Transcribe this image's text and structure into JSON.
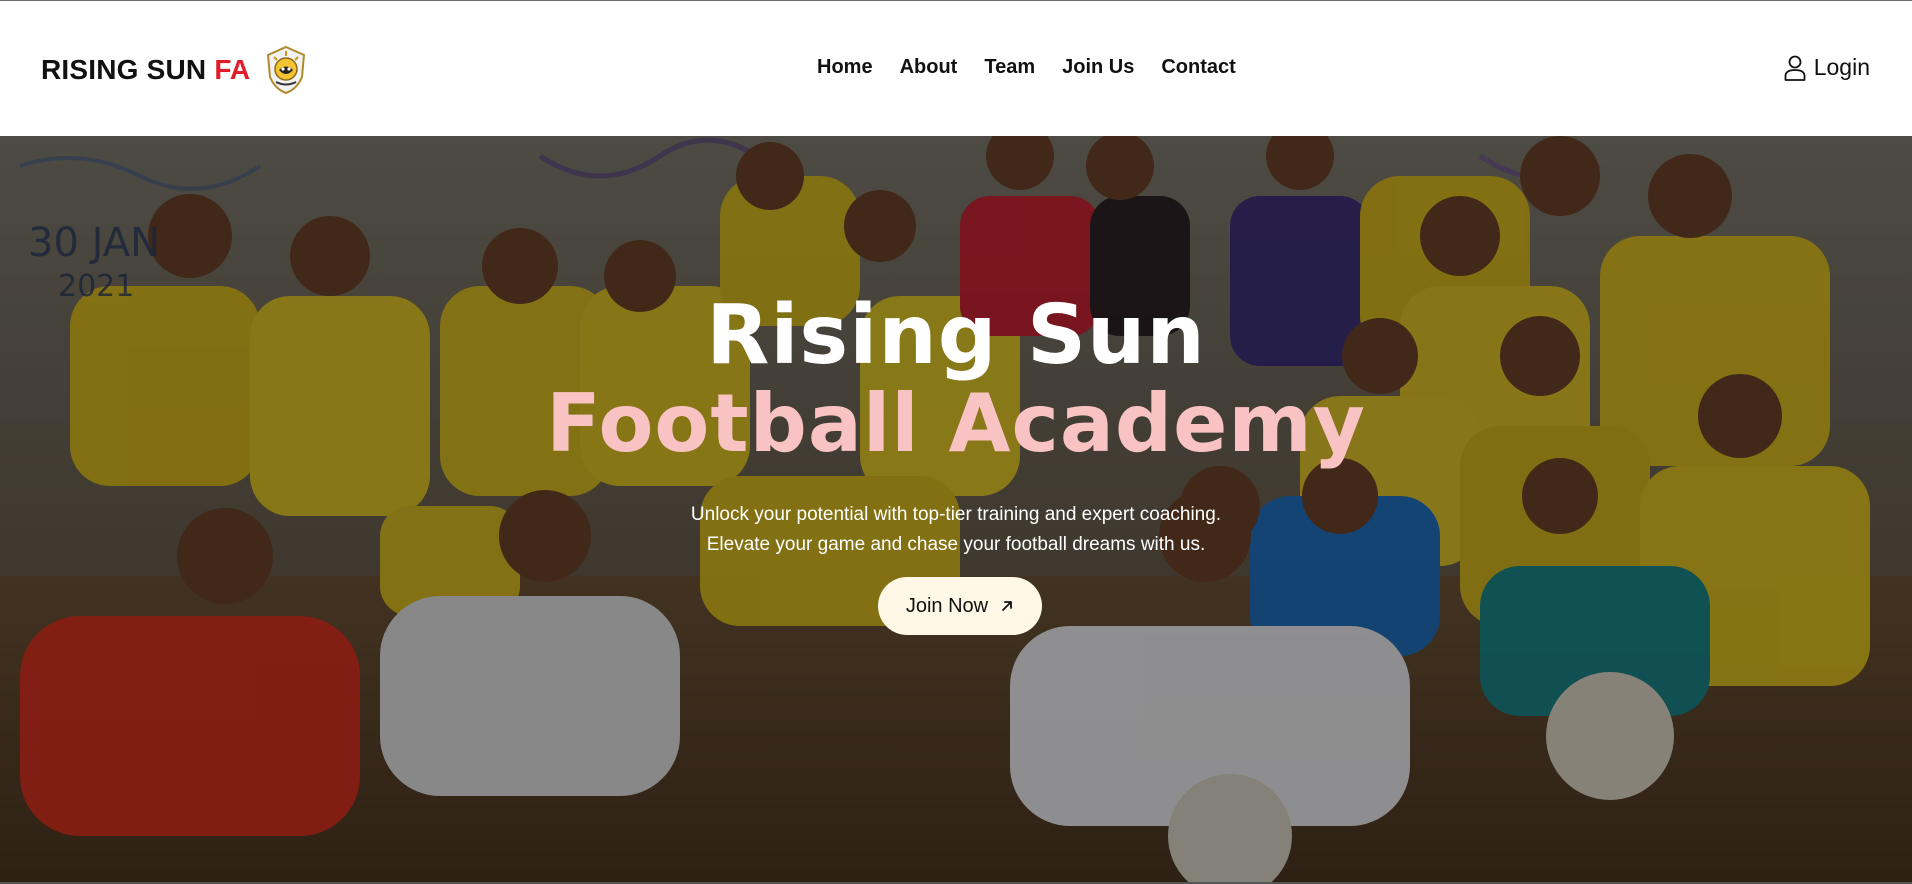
{
  "brand": {
    "name": "RISING SUN",
    "accent": "FA",
    "accent_color": "#e11d2a",
    "logo_icon": "crest-icon"
  },
  "nav": {
    "items": [
      {
        "label": "Home"
      },
      {
        "label": "About"
      },
      {
        "label": "Team"
      },
      {
        "label": "Join Us"
      },
      {
        "label": "Contact"
      }
    ],
    "login": {
      "label": "Login",
      "icon": "user-icon"
    }
  },
  "hero": {
    "title_line1": "Rising Sun",
    "title_line2": "Football Academy",
    "subtitle_line1": "Unlock your potential with top-tier training and expert coaching.",
    "subtitle_line2": "Elevate your game and chase your football dreams with us.",
    "cta": {
      "label": "Join Now",
      "icon": "arrow-up-right-icon"
    },
    "background": "team-group-photo",
    "title_line2_color": "#f9c3c3"
  }
}
